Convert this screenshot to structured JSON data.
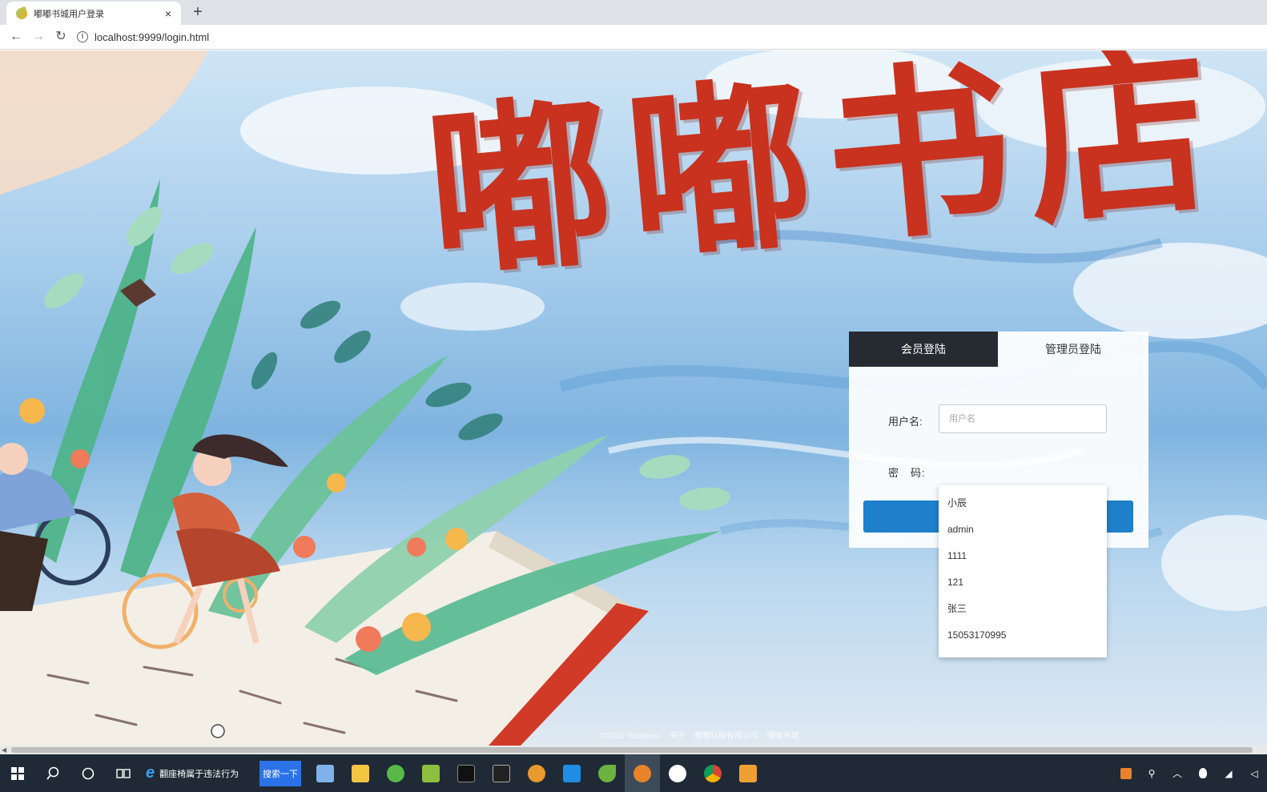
{
  "browser": {
    "tab_title": "嘟嘟书城用户登录",
    "tab_close": "×",
    "new_tab": "+",
    "back": "←",
    "forward": "→",
    "reload": "↻",
    "url": "localhost:9999/login.html"
  },
  "page": {
    "brand_title": "嘟嘟书店",
    "tabs": {
      "member": "会员登陆",
      "admin": "管理员登陆"
    },
    "form": {
      "username_label": "用户名:",
      "username_placeholder": "用户名",
      "password_label": "密　码:"
    },
    "autocomplete": [
      "小辰",
      "admin",
      "1111",
      "121",
      "张三",
      "15053170995"
    ],
    "footer": {
      "copyright": "©2019 Youtiaoxc",
      "about": "关于",
      "company": "嘟嘟科技有限公司",
      "site": "嘟嘟书城"
    }
  },
  "taskbar": {
    "search_hint": "翻座椅属于违法行为",
    "search_button": "搜索一下",
    "ie_letter": "e"
  },
  "colors": {
    "brand_red": "#c8321f",
    "active_tab": "#252b31",
    "login_button": "#1e7fcb",
    "taskbar": "#1f2a36"
  }
}
